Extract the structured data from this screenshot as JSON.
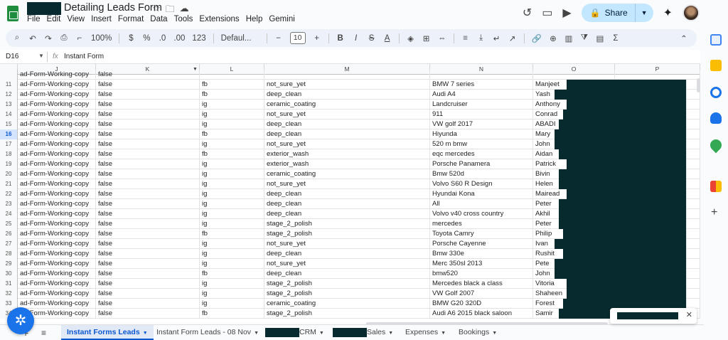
{
  "app": {
    "title": "Detailing Leads Form",
    "menu": [
      "File",
      "Edit",
      "View",
      "Insert",
      "Format",
      "Data",
      "Tools",
      "Extensions",
      "Help",
      "Gemini"
    ],
    "share_label": "Share"
  },
  "toolbar": {
    "zoom": "100%",
    "currency": "$",
    "percent": "%",
    "decimal_dec": ".0",
    "decimal_inc": ".00",
    "number_format": "123",
    "font": "Defaul...",
    "font_size": "10",
    "minus": "−",
    "plus": "+",
    "bold": "B",
    "italic": "I",
    "strike": "S",
    "text_color": "A"
  },
  "formula_bar": {
    "cell_ref": "D16",
    "fx": "fx",
    "content": "Instant Form"
  },
  "columns": [
    "J",
    "K",
    "L",
    "M",
    "N",
    "O",
    "P"
  ],
  "rows": [
    {
      "n": "11",
      "j": "ad-Form-Working-copy",
      "k": "false",
      "l": "fb",
      "m": "not_sure_yet",
      "nn": "BMW 7 series",
      "o": "Manjeet"
    },
    {
      "n": "12",
      "j": "ad-Form-Working-copy",
      "k": "false",
      "l": "fb",
      "m": "deep_clean",
      "nn": "Audi A4",
      "o": "Yash"
    },
    {
      "n": "13",
      "j": "ad-Form-Working-copy",
      "k": "false",
      "l": "ig",
      "m": "ceramic_coating",
      "nn": "Landcruiser",
      "o": "Anthony"
    },
    {
      "n": "14",
      "j": "ad-Form-Working-copy",
      "k": "false",
      "l": "ig",
      "m": "not_sure_yet",
      "nn": "911",
      "o": "Conrad"
    },
    {
      "n": "15",
      "j": "ad-Form-Working-copy",
      "k": "false",
      "l": "ig",
      "m": "deep_clean",
      "nn": "VW golf 2017",
      "o": "ABADI"
    },
    {
      "n": "16",
      "j": "ad-Form-Working-copy",
      "k": "false",
      "l": "fb",
      "m": "deep_clean",
      "nn": "Hiyunda",
      "o": "Mary"
    },
    {
      "n": "17",
      "j": "ad-Form-Working-copy",
      "k": "false",
      "l": "ig",
      "m": "not_sure_yet",
      "nn": "520 m bmw",
      "o": "John"
    },
    {
      "n": "18",
      "j": "ad-Form-Working-copy",
      "k": "false",
      "l": "fb",
      "m": "exterior_wash",
      "nn": "eqc mercedes",
      "o": "Aidan"
    },
    {
      "n": "19",
      "j": "ad-Form-Working-copy",
      "k": "false",
      "l": "ig",
      "m": "exterior_wash",
      "nn": "Porsche Panamera",
      "o": "Patrick"
    },
    {
      "n": "20",
      "j": "ad-Form-Working-copy",
      "k": "false",
      "l": "ig",
      "m": "ceramic_coating",
      "nn": "Bmw 520d",
      "o": "Bivin"
    },
    {
      "n": "21",
      "j": "ad-Form-Working-copy",
      "k": "false",
      "l": "ig",
      "m": "not_sure_yet",
      "nn": "Volvo S60 R Design",
      "o": "Helen"
    },
    {
      "n": "22",
      "j": "ad-Form-Working-copy",
      "k": "false",
      "l": "ig",
      "m": "deep_clean",
      "nn": "Hyundai Kona",
      "o": "Mairead"
    },
    {
      "n": "23",
      "j": "ad-Form-Working-copy",
      "k": "false",
      "l": "ig",
      "m": "deep_clean",
      "nn": "All",
      "o": "Peter"
    },
    {
      "n": "24",
      "j": "ad-Form-Working-copy",
      "k": "false",
      "l": "ig",
      "m": "deep_clean",
      "nn": "Volvo v40 cross country",
      "o": "Akhil"
    },
    {
      "n": "25",
      "j": "ad-Form-Working-copy",
      "k": "false",
      "l": "ig",
      "m": "stage_2_polish",
      "nn": "mercedes",
      "o": "Peter"
    },
    {
      "n": "26",
      "j": "ad-Form-Working-copy",
      "k": "false",
      "l": "fb",
      "m": "stage_2_polish",
      "nn": "Toyota Camry",
      "o": "Philip"
    },
    {
      "n": "27",
      "j": "ad-Form-Working-copy",
      "k": "false",
      "l": "ig",
      "m": "not_sure_yet",
      "nn": "Porsche Cayenne",
      "o": "Ivan"
    },
    {
      "n": "28",
      "j": "ad-Form-Working-copy",
      "k": "false",
      "l": "ig",
      "m": "deep_clean",
      "nn": "Bmw 330e",
      "o": "Rushit"
    },
    {
      "n": "29",
      "j": "ad-Form-Working-copy",
      "k": "false",
      "l": "ig",
      "m": "not_sure_yet",
      "nn": "Merc 350sl 2013",
      "o": "Pete"
    },
    {
      "n": "30",
      "j": "ad-Form-Working-copy",
      "k": "false",
      "l": "fb",
      "m": "deep_clean",
      "nn": "bmw520",
      "o": "John"
    },
    {
      "n": "31",
      "j": "ad-Form-Working-copy",
      "k": "false",
      "l": "ig",
      "m": "stage_2_polish",
      "nn": "Mercedes black a class",
      "o": "Vitoria"
    },
    {
      "n": "32",
      "j": "ad-Form-Working-copy",
      "k": "false",
      "l": "ig",
      "m": "stage_2_polish",
      "nn": "VW Golf 2007",
      "o": "Shaheen"
    },
    {
      "n": "33",
      "j": "ad-Form-Working-copy",
      "k": "false",
      "l": "ig",
      "m": "ceramic_coating",
      "nn": "BMW G20 320D",
      "o": "Forest"
    },
    {
      "n": "34",
      "j": "ad-Form-Working-copy",
      "k": "false",
      "l": "fb",
      "m": "stage_2_polish",
      "nn": "Audi A6 2015 black saloon",
      "o": "Samir"
    }
  ],
  "tabs": {
    "active": "Instant Forms Leads",
    "t2": "Instant Form Leads - 08 Nov",
    "t3_suffix": "CRM",
    "t4_suffix": "Sales",
    "t5": "Expenses",
    "t6": "Bookings"
  },
  "colors": {
    "accent": "#0b57d0",
    "share_bg": "#c2e7ff",
    "redaction": "#062a2e"
  }
}
